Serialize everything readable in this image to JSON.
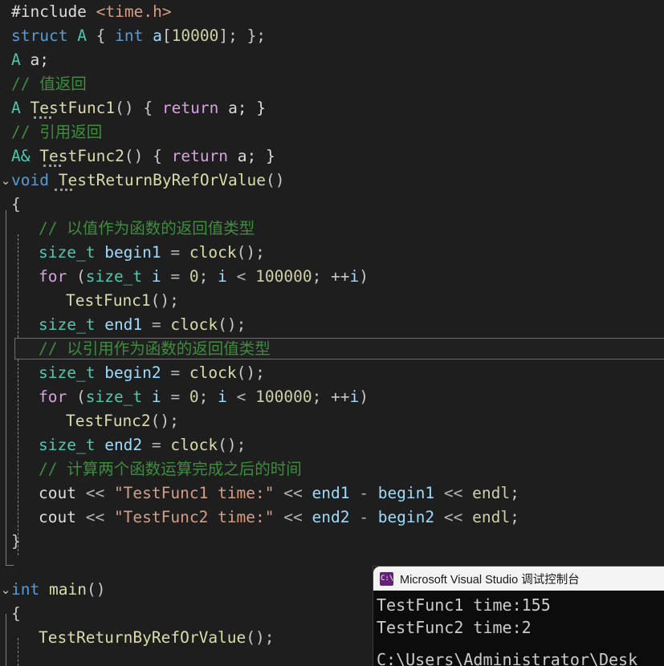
{
  "editor": {
    "theme_background": "#1e1e1e",
    "lines": [
      {
        "n": 1,
        "indent": 0,
        "fold": "",
        "tokens": [
          {
            "t": "#include ",
            "c": "plain"
          },
          {
            "t": "<time.h>",
            "c": "str"
          }
        ]
      },
      {
        "n": 2,
        "indent": 0,
        "fold": "",
        "tokens": [
          {
            "t": "struct ",
            "c": "kw"
          },
          {
            "t": "A",
            "c": "type"
          },
          {
            "t": " { ",
            "c": "punct"
          },
          {
            "t": "int ",
            "c": "kw"
          },
          {
            "t": "a",
            "c": "var"
          },
          {
            "t": "[",
            "c": "punct"
          },
          {
            "t": "10000",
            "c": "num"
          },
          {
            "t": "]; };",
            "c": "punct"
          }
        ]
      },
      {
        "n": 3,
        "indent": 0,
        "fold": "",
        "tokens": [
          {
            "t": "A",
            "c": "type"
          },
          {
            "t": " a;",
            "c": "plain"
          }
        ]
      },
      {
        "n": 4,
        "indent": 0,
        "fold": "",
        "tokens": [
          {
            "t": "// 值返回",
            "c": "cmt"
          }
        ]
      },
      {
        "n": 5,
        "indent": 0,
        "fold": "",
        "tokens": [
          {
            "t": "A",
            "c": "type"
          },
          {
            "t": " ",
            "c": "plain"
          },
          {
            "t": "TestFunc1",
            "c": "fn"
          },
          {
            "t": "() { ",
            "c": "punct"
          },
          {
            "t": "return",
            "c": "ctrl"
          },
          {
            "t": " a; }",
            "c": "plain"
          }
        ],
        "dotted_at": 28
      },
      {
        "n": 6,
        "indent": 0,
        "fold": "",
        "tokens": [
          {
            "t": "// 引用返回",
            "c": "cmt"
          }
        ]
      },
      {
        "n": 7,
        "indent": 0,
        "fold": "",
        "tokens": [
          {
            "t": "A&",
            "c": "type"
          },
          {
            "t": " ",
            "c": "plain"
          },
          {
            "t": "TestFunc2",
            "c": "fn"
          },
          {
            "t": "() { ",
            "c": "punct"
          },
          {
            "t": "return",
            "c": "ctrl"
          },
          {
            "t": " a; }",
            "c": "plain"
          }
        ],
        "dotted_at": 40
      },
      {
        "n": 8,
        "indent": 0,
        "fold": "⌄",
        "tokens": [
          {
            "t": "void",
            "c": "kw"
          },
          {
            "t": " ",
            "c": "plain"
          },
          {
            "t": "TestReturnByRefOrValue",
            "c": "fn"
          },
          {
            "t": "()",
            "c": "punct"
          }
        ],
        "dotted_at": 54
      },
      {
        "n": 9,
        "indent": 0,
        "fold": "",
        "tokens": [
          {
            "t": "{",
            "c": "punct"
          }
        ]
      },
      {
        "n": 10,
        "indent": 1,
        "fold": "",
        "tokens": [
          {
            "t": "// 以值作为函数的返回值类型",
            "c": "cmt"
          }
        ]
      },
      {
        "n": 11,
        "indent": 1,
        "fold": "",
        "tokens": [
          {
            "t": "size_t",
            "c": "type"
          },
          {
            "t": " ",
            "c": "plain"
          },
          {
            "t": "begin1",
            "c": "var"
          },
          {
            "t": " = ",
            "c": "op"
          },
          {
            "t": "clock",
            "c": "fn"
          },
          {
            "t": "();",
            "c": "punct"
          }
        ]
      },
      {
        "n": 12,
        "indent": 1,
        "fold": "",
        "tokens": [
          {
            "t": "for",
            "c": "ctrl"
          },
          {
            "t": " (",
            "c": "punct"
          },
          {
            "t": "size_t",
            "c": "type"
          },
          {
            "t": " ",
            "c": "plain"
          },
          {
            "t": "i",
            "c": "var"
          },
          {
            "t": " = ",
            "c": "op"
          },
          {
            "t": "0",
            "c": "num"
          },
          {
            "t": "; ",
            "c": "punct"
          },
          {
            "t": "i",
            "c": "var"
          },
          {
            "t": " < ",
            "c": "op"
          },
          {
            "t": "100000",
            "c": "num"
          },
          {
            "t": "; ++",
            "c": "punct"
          },
          {
            "t": "i",
            "c": "var"
          },
          {
            "t": ")",
            "c": "punct"
          }
        ]
      },
      {
        "n": 13,
        "indent": 2,
        "fold": "",
        "tokens": [
          {
            "t": "TestFunc1",
            "c": "fn"
          },
          {
            "t": "();",
            "c": "punct"
          }
        ]
      },
      {
        "n": 14,
        "indent": 1,
        "fold": "",
        "tokens": [
          {
            "t": "size_t",
            "c": "type"
          },
          {
            "t": " ",
            "c": "plain"
          },
          {
            "t": "end1",
            "c": "var"
          },
          {
            "t": " = ",
            "c": "op"
          },
          {
            "t": "clock",
            "c": "fn"
          },
          {
            "t": "();",
            "c": "punct"
          }
        ]
      },
      {
        "n": 15,
        "indent": 1,
        "fold": "",
        "current": true,
        "tokens": [
          {
            "t": "// 以引用作为函数的返回值类型",
            "c": "cmt"
          }
        ]
      },
      {
        "n": 16,
        "indent": 1,
        "fold": "",
        "tokens": [
          {
            "t": "size_t",
            "c": "type"
          },
          {
            "t": " ",
            "c": "plain"
          },
          {
            "t": "begin2",
            "c": "var"
          },
          {
            "t": " = ",
            "c": "op"
          },
          {
            "t": "clock",
            "c": "fn"
          },
          {
            "t": "();",
            "c": "punct"
          }
        ]
      },
      {
        "n": 17,
        "indent": 1,
        "fold": "",
        "tokens": [
          {
            "t": "for",
            "c": "ctrl"
          },
          {
            "t": " (",
            "c": "punct"
          },
          {
            "t": "size_t",
            "c": "type"
          },
          {
            "t": " ",
            "c": "plain"
          },
          {
            "t": "i",
            "c": "var"
          },
          {
            "t": " = ",
            "c": "op"
          },
          {
            "t": "0",
            "c": "num"
          },
          {
            "t": "; ",
            "c": "punct"
          },
          {
            "t": "i",
            "c": "var"
          },
          {
            "t": " < ",
            "c": "op"
          },
          {
            "t": "100000",
            "c": "num"
          },
          {
            "t": "; ++",
            "c": "punct"
          },
          {
            "t": "i",
            "c": "var"
          },
          {
            "t": ")",
            "c": "punct"
          }
        ]
      },
      {
        "n": 18,
        "indent": 2,
        "fold": "",
        "tokens": [
          {
            "t": "TestFunc2",
            "c": "fn"
          },
          {
            "t": "();",
            "c": "punct"
          }
        ]
      },
      {
        "n": 19,
        "indent": 1,
        "fold": "",
        "tokens": [
          {
            "t": "size_t",
            "c": "type"
          },
          {
            "t": " ",
            "c": "plain"
          },
          {
            "t": "end2",
            "c": "var"
          },
          {
            "t": " = ",
            "c": "op"
          },
          {
            "t": "clock",
            "c": "fn"
          },
          {
            "t": "();",
            "c": "punct"
          }
        ]
      },
      {
        "n": 20,
        "indent": 1,
        "fold": "",
        "tokens": [
          {
            "t": "// 计算两个函数运算完成之后的时间",
            "c": "cmt"
          }
        ]
      },
      {
        "n": 21,
        "indent": 1,
        "fold": "",
        "tokens": [
          {
            "t": "cout",
            "c": "plain"
          },
          {
            "t": " << ",
            "c": "op"
          },
          {
            "t": "\"TestFunc1 time:\"",
            "c": "str"
          },
          {
            "t": " << ",
            "c": "op"
          },
          {
            "t": "end1",
            "c": "var"
          },
          {
            "t": " - ",
            "c": "op"
          },
          {
            "t": "begin1",
            "c": "var"
          },
          {
            "t": " << ",
            "c": "op"
          },
          {
            "t": "endl",
            "c": "num"
          },
          {
            "t": ";",
            "c": "punct"
          }
        ]
      },
      {
        "n": 22,
        "indent": 1,
        "fold": "",
        "tokens": [
          {
            "t": "cout",
            "c": "plain"
          },
          {
            "t": " << ",
            "c": "op"
          },
          {
            "t": "\"TestFunc2 time:\"",
            "c": "str"
          },
          {
            "t": " << ",
            "c": "op"
          },
          {
            "t": "end2",
            "c": "var"
          },
          {
            "t": " - ",
            "c": "op"
          },
          {
            "t": "begin2",
            "c": "var"
          },
          {
            "t": " << ",
            "c": "op"
          },
          {
            "t": "endl",
            "c": "num"
          },
          {
            "t": ";",
            "c": "punct"
          }
        ]
      },
      {
        "n": 23,
        "indent": 0,
        "fold": "",
        "tokens": [
          {
            "t": "}",
            "c": "punct"
          }
        ]
      },
      {
        "n": 24,
        "indent": 0,
        "fold": "",
        "tokens": []
      },
      {
        "n": 25,
        "indent": 0,
        "fold": "⌄",
        "tokens": [
          {
            "t": "int",
            "c": "kw"
          },
          {
            "t": " ",
            "c": "plain"
          },
          {
            "t": "main",
            "c": "fn"
          },
          {
            "t": "()",
            "c": "punct"
          }
        ]
      },
      {
        "n": 26,
        "indent": 0,
        "fold": "",
        "tokens": [
          {
            "t": "{",
            "c": "punct"
          }
        ]
      },
      {
        "n": 27,
        "indent": 1,
        "fold": "",
        "tokens": [
          {
            "t": "TestReturnByRefOrValue",
            "c": "fn"
          },
          {
            "t": "();",
            "c": "punct"
          }
        ]
      }
    ]
  },
  "console": {
    "title": "Microsoft Visual Studio 调试控制台",
    "icon": "console-window-icon",
    "output_lines": [
      "TestFunc1 time:155",
      "TestFunc2 time:2",
      "",
      "C:\\Users\\Administrator\\Desk"
    ]
  }
}
